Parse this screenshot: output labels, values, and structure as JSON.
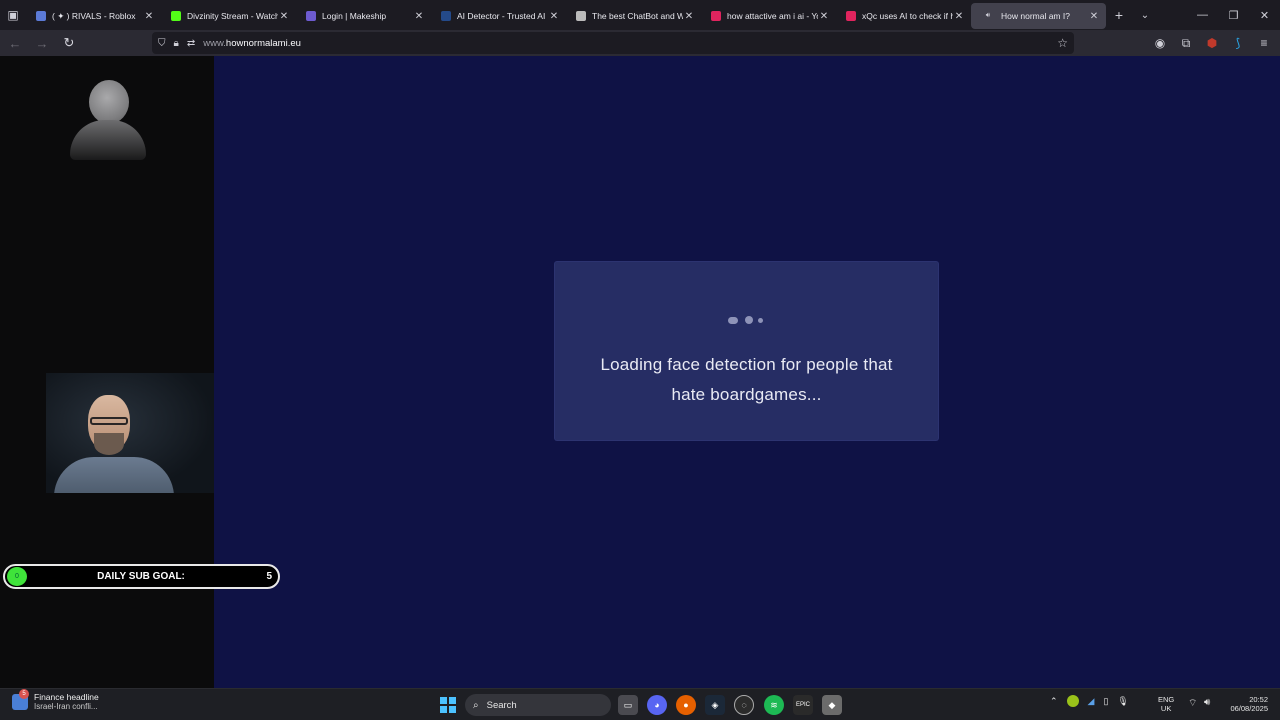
{
  "browser": {
    "tabs": [
      {
        "title": "( ✦ ) RIVALS - Roblox",
        "icon": "roblox-icon",
        "color": "#5b7ad6"
      },
      {
        "title": "Divzinity Stream - Watch Live",
        "icon": "kick-icon",
        "color": "#53fc18"
      },
      {
        "title": "Login | Makeship",
        "icon": "makeship-icon",
        "color": "#6d5bd0"
      },
      {
        "title": "AI Detector - Trusted AI Checker",
        "icon": "ai-detector-icon",
        "color": "#244a8a"
      },
      {
        "title": "The best ChatBot and Widget",
        "icon": "chatbot-icon",
        "color": "#bbbbbb"
      },
      {
        "title": "how attactive am i ai - YouTube",
        "icon": "youtube-icon",
        "color": "#e0245e"
      },
      {
        "title": "xQc uses AI to check if he is attractive",
        "icon": "youtube-icon",
        "color": "#e0245e"
      },
      {
        "title": "How normal am I?",
        "icon": "audio-icon",
        "color": "#cfcfd8",
        "active": true
      }
    ],
    "url_prefix": "www.",
    "url_domain": "hownormalami.eu"
  },
  "overlay": {
    "sub_goal_label": "DAILY SUB GOAL:",
    "sub_goal_count": "5",
    "sub_goal_icon": "0"
  },
  "loading": {
    "line1": "Loading face detection for people that",
    "line2": "hate boardgames..."
  },
  "taskbar": {
    "news_badge": "5",
    "news_title": "Finance headline",
    "news_subtitle": "Israel-Iran confli...",
    "search_label": "Search",
    "lang_top": "ENG",
    "lang_bottom": "UK",
    "time": "20:52",
    "date": "06/08/2025"
  }
}
